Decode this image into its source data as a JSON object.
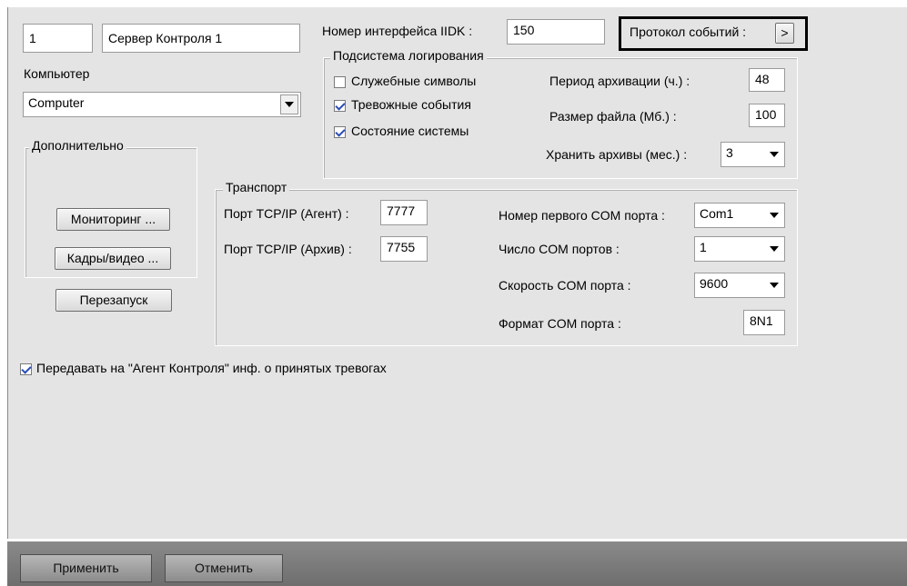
{
  "server": {
    "number": "1",
    "name": "Сервер Контроля 1"
  },
  "computer": {
    "label": "Компьютер",
    "value": "Computer"
  },
  "additional": {
    "title": "Дополнительно",
    "monitoring_button": "Мониторинг ...",
    "frames_button": "Кадры/видео ...",
    "restart_button": "Перезапуск"
  },
  "iidk": {
    "label": "Номер интерфейса IIDK :",
    "value": "150"
  },
  "protocol": {
    "label": "Протокол событий :",
    "button": ">"
  },
  "logging": {
    "title": "Подсистема логирования",
    "service_symbols": {
      "label": "Служебные символы",
      "checked": false
    },
    "alarm_events": {
      "label": "Тревожные события",
      "checked": true
    },
    "system_state": {
      "label": "Состояние системы",
      "checked": true
    },
    "archive_period": {
      "label": "Период архивации (ч.) :",
      "value": "48"
    },
    "file_size": {
      "label": "Размер файла (Мб.) :",
      "value": "100"
    },
    "keep_archives": {
      "label": "Хранить архивы (мес.) :",
      "value": "3"
    }
  },
  "transport": {
    "title": "Транспорт",
    "tcp_agent": {
      "label": "Порт TCP/IP (Агент) :",
      "value": "7777"
    },
    "tcp_archive": {
      "label": "Порт TCP/IP (Архив) :",
      "value": "7755"
    },
    "first_com": {
      "label": "Номер первого COM порта :",
      "value": "Com1"
    },
    "com_count": {
      "label": "Число COM портов :",
      "value": "1"
    },
    "com_speed": {
      "label": "Скорость COM порта :",
      "value": "9600"
    },
    "com_format": {
      "label": "Формат COM порта :",
      "value": "8N1"
    }
  },
  "forward": {
    "label": "Передавать на \"Агент Контроля\" инф. о принятых тревогах",
    "checked": true
  },
  "footer": {
    "apply": "Применить",
    "cancel": "Отменить"
  }
}
